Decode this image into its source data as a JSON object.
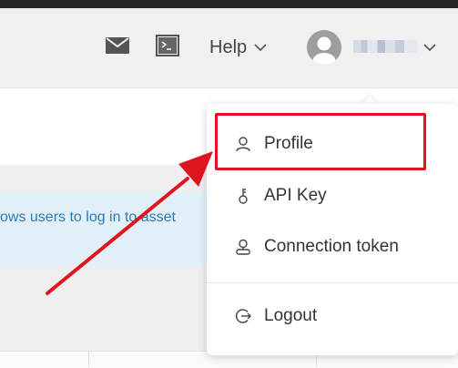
{
  "header": {
    "mail_icon": "mail-icon",
    "terminal_icon": "terminal-icon",
    "help_label": "Help",
    "help_icon": "chevron-down-icon",
    "avatar_icon": "user-avatar",
    "user_menu_icon": "chevron-down-icon"
  },
  "banner": {
    "text": "ows users to log in to asset"
  },
  "user_menu": {
    "items": [
      {
        "label": "Profile",
        "icon": "user-icon",
        "highlighted": true
      },
      {
        "label": "API Key",
        "icon": "key-icon"
      },
      {
        "label": "Connection token",
        "icon": "token-icon"
      },
      {
        "label": "Logout",
        "icon": "logout-icon"
      }
    ]
  },
  "colors": {
    "annotation_red": "#e0141e",
    "banner_text": "#2e7ab4",
    "banner_bg": "#e1f0f8"
  }
}
